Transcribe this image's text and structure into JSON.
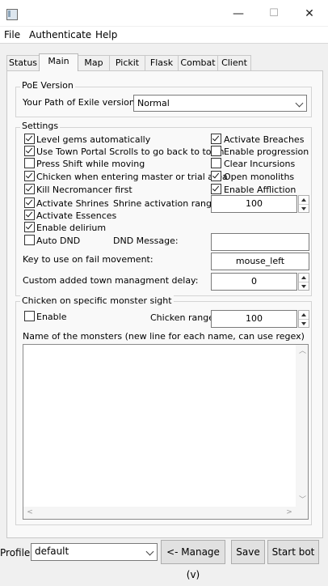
{
  "window": {
    "close_glyph": "✕",
    "maximize_glyph": "☐",
    "minimize_glyph": "—"
  },
  "menu": [
    "File",
    "Authenticate",
    "Help"
  ],
  "tabs": [
    "Status",
    "Main",
    "Map",
    "Pickit",
    "Flask",
    "Combat",
    "Client"
  ],
  "active_tab": "Main",
  "poe_version": {
    "group_title": "PoE Version",
    "label": "Your Path of Exile version:",
    "value": "Normal"
  },
  "settings": {
    "group_title": "Settings",
    "level_gems": {
      "label": "Level gems automatically",
      "checked": true
    },
    "town_portal": {
      "label": "Use Town Portal Scrolls to go back to town",
      "checked": true
    },
    "press_shift": {
      "label": "Press Shift while moving",
      "checked": false
    },
    "chicken_master": {
      "label": "Chicken when entering master or trial area",
      "checked": true
    },
    "kill_necromancer": {
      "label": "Kill Necromancer first",
      "checked": true
    },
    "activate_shrines": {
      "label": "Activate Shrines",
      "checked": true
    },
    "activate_essences": {
      "label": "Activate Essences",
      "checked": true
    },
    "enable_delirium": {
      "label": "Enable delirium",
      "checked": true
    },
    "auto_dnd": {
      "label": "Auto DND",
      "checked": false
    },
    "activate_breaches": {
      "label": "Activate Breaches",
      "checked": true
    },
    "enable_progression": {
      "label": "Enable progression",
      "checked": false
    },
    "clear_incursions": {
      "label": "Clear Incursions",
      "checked": false
    },
    "open_monoliths": {
      "label": "Open monoliths",
      "checked": true
    },
    "enable_affliction": {
      "label": "Enable Affliction",
      "checked": true
    },
    "shrine_range_label": "Shrine activation range:",
    "shrine_range_value": "100",
    "dnd_label": "DND Message:",
    "dnd_value": "",
    "fail_key_label": "Key to use on fail movement:",
    "fail_key_value": "mouse_left",
    "town_delay_label": "Custom added town managment delay:",
    "town_delay_value": "0"
  },
  "chicken": {
    "group_title": "Chicken on specific monster sight",
    "enable": {
      "label": "Enable",
      "checked": false
    },
    "range_label": "Chicken range:",
    "range_value": "100",
    "monsters_label": "Name of the monsters (new line for each name, can use regex)",
    "monsters_value": ""
  },
  "footer": {
    "profile_label": "Profile:",
    "profile_value": "default",
    "manage_label": "<- Manage (v)",
    "save_label": "Save",
    "start_label": "Start bot"
  }
}
